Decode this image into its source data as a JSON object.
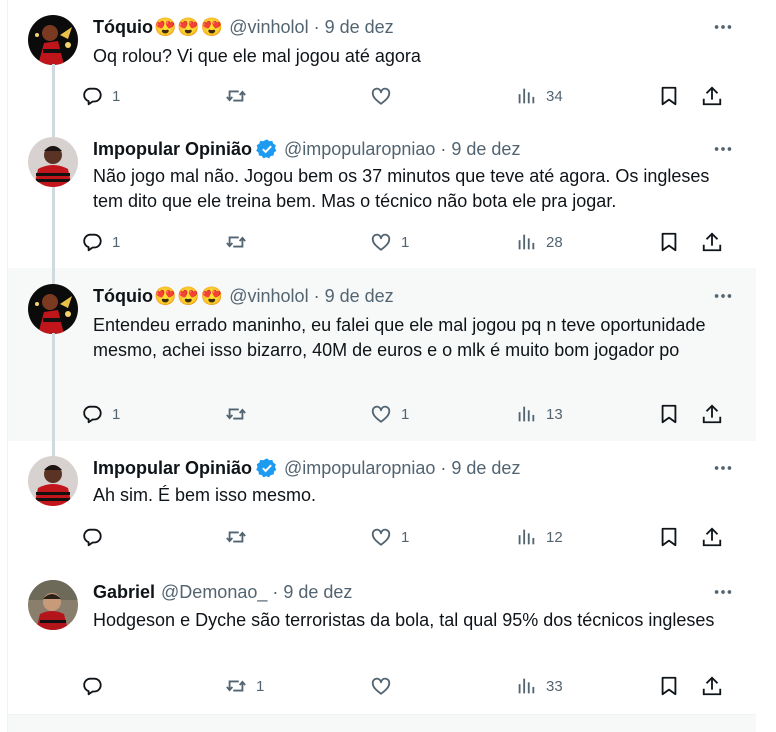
{
  "tweets": [
    {
      "name": "Tóquio",
      "emojis": [
        "😍",
        "😍",
        "😍"
      ],
      "verified": false,
      "handle": "@vinholol",
      "date": "9 de dez",
      "text": "Oq rolou? Vi que ele mal jogou até agora",
      "replies": "1",
      "retweets": "",
      "likes": "",
      "views": "34",
      "avatar": "avatar-toquio",
      "highlighted": false
    },
    {
      "name": "Impopular Opinião",
      "emojis": [],
      "verified": true,
      "handle": "@impopularopniao",
      "date": "9 de dez",
      "text": "Não jogo mal não. Jogou bem os 37 minutos que teve até agora. Os ingleses tem dito que ele treina bem. Mas o técnico não bota ele pra jogar.",
      "replies": "1",
      "retweets": "",
      "likes": "1",
      "views": "28",
      "avatar": "avatar-flamengo",
      "highlighted": false
    },
    {
      "name": "Tóquio",
      "emojis": [
        "😍",
        "😍",
        "😍"
      ],
      "verified": false,
      "handle": "@vinholol",
      "date": "9 de dez",
      "text": "Entendeu errado maninho, eu falei que ele mal jogou pq n teve oportunidade mesmo, achei isso bizarro, 40M de euros e o mlk é muito bom jogador po",
      "replies": "1",
      "retweets": "",
      "likes": "1",
      "views": "13",
      "avatar": "avatar-toquio",
      "highlighted": true
    },
    {
      "name": "Impopular Opinião",
      "emojis": [],
      "verified": true,
      "handle": "@impopularopniao",
      "date": "9 de dez",
      "text": "Ah sim. É bem isso mesmo.",
      "replies": "",
      "retweets": "",
      "likes": "1",
      "views": "12",
      "avatar": "avatar-flamengo",
      "highlighted": false
    },
    {
      "name": "Gabriel",
      "emojis": [],
      "verified": false,
      "handle": "@Demonao_",
      "date": "9 de dez",
      "text": "Hodgeson e Dyche são terroristas da bola, tal qual 95% dos técnicos ingleses",
      "replies": "",
      "retweets": "1",
      "likes": "",
      "views": "33",
      "avatar": "avatar-gabriel",
      "highlighted": false
    }
  ],
  "icons": {
    "more": "more-icon",
    "reply": "reply-icon",
    "retweet": "retweet-icon",
    "like": "like-icon",
    "views": "views-icon",
    "bookmark": "bookmark-icon",
    "share": "share-icon",
    "verified": "verified-badge-icon"
  },
  "colors": {
    "text": "#0f1419",
    "secondary": "#536471",
    "verified": "#1d9bf0",
    "thread_line": "#cfd9de",
    "highlight_bg": "#f7f9f9"
  }
}
